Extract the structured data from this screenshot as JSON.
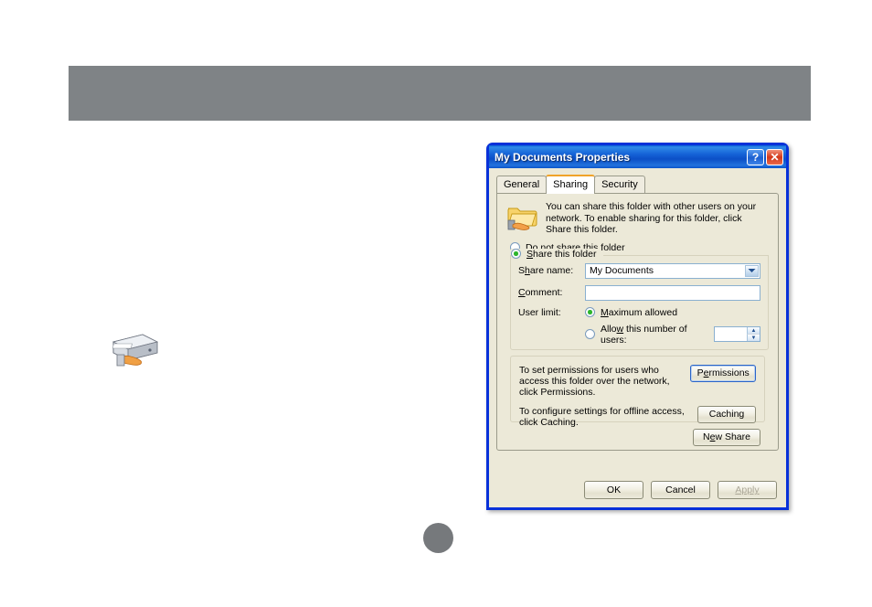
{
  "page": {
    "header_bar": "",
    "page_bullet_label": "",
    "drive_icon_name": "shared-drive-icon"
  },
  "dialog": {
    "title": "My Documents Properties",
    "titlebar_buttons": [
      {
        "name": "help-button",
        "glyph": "?"
      },
      {
        "name": "close-button",
        "glyph": "✕"
      }
    ],
    "tabs": [
      {
        "label": "General",
        "active": false
      },
      {
        "label": "Sharing",
        "active": true
      },
      {
        "label": "Security",
        "active": false
      }
    ],
    "sharing": {
      "info_text": "You can share this folder with other users on your network.  To enable sharing for this folder, click Share this folder.",
      "radio_do_not_share": {
        "label_pre": "Do ",
        "label_accel": "n",
        "label_post": "ot share this folder",
        "checked": false
      },
      "radio_share": {
        "label_pre": "",
        "label_accel": "S",
        "label_post": "hare this folder",
        "checked": true
      },
      "share_name_label_pre": "S",
      "share_name_label_accel": "h",
      "share_name_label_post": "are name:",
      "share_name_value": "My Documents",
      "comment_label_accel": "C",
      "comment_label_post": "omment:",
      "comment_value": "",
      "comment_placeholder": "",
      "user_limit_label": "User limit:",
      "radio_maximum": {
        "label_pre": "",
        "label_accel": "M",
        "label_post": "aximum allowed",
        "checked": true
      },
      "radio_allow_number": {
        "label_pre": "Allo",
        "label_accel": "w",
        "label_post": " this number of users:",
        "checked": false
      },
      "user_count_value": "",
      "permissions_desc": "To set permissions for users who access this folder over the network, click Permissions.",
      "permissions_button_pre": "P",
      "permissions_button_accel": "e",
      "permissions_button_post": "rmissions",
      "caching_desc": "To configure settings for offline access, click Caching.",
      "caching_button": "Caching",
      "new_share_button_pre": "N",
      "new_share_button_accel": "e",
      "new_share_button_post": "w Share"
    },
    "buttons": {
      "ok": "OK",
      "cancel": "Cancel",
      "apply": "Apply"
    }
  },
  "colors": {
    "titlebar_blue": "#0831d9",
    "dialog_face": "#ece9d8",
    "header_gray": "#7f8386",
    "tab_accent_orange": "#f0a32a",
    "radio_green": "#2db52d",
    "close_red": "#d2381a"
  }
}
